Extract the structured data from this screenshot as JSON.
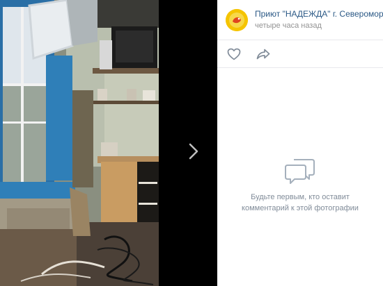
{
  "post": {
    "author": "Приют \"НАДЕЖДА\" г. Североморск",
    "time": "четыре часа назад"
  },
  "icons": {
    "like": "heart-icon",
    "share": "share-arrow-icon",
    "next": "chevron-right-icon",
    "comments": "comment-bubbles-icon"
  },
  "comments": {
    "empty_text": "Будьте первым, кто оставит комментарий к этой фотографии"
  },
  "colors": {
    "link": "#2a5885",
    "muted": "#939393",
    "icon": "#818c99",
    "avatar": "#f5c400"
  }
}
